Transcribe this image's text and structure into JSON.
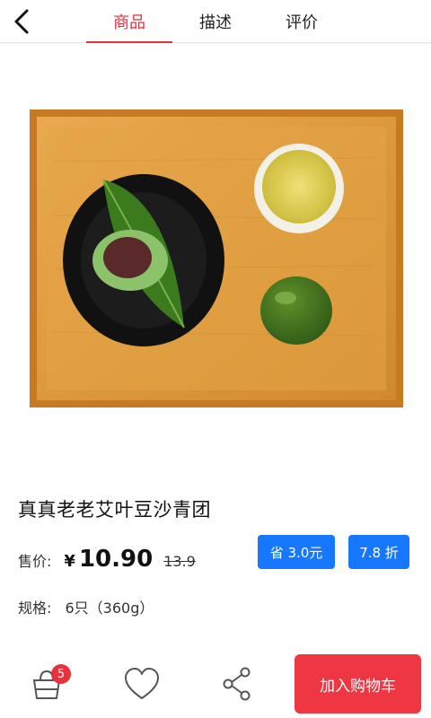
{
  "header": {
    "tabs": [
      {
        "label": "商品",
        "active": true
      },
      {
        "label": "描述",
        "active": false
      },
      {
        "label": "评价",
        "active": false
      }
    ]
  },
  "product": {
    "title": "真真老老艾叶豆沙青团",
    "price_label": "售价:",
    "currency": "¥",
    "price": "10.90",
    "original_price": "13.9",
    "save_badge": "省 3.0元",
    "discount_badge": "7.8 折",
    "spec_label": "规格:",
    "spec_value": "6只（360g）"
  },
  "bottom_bar": {
    "cart_count": "5",
    "add_to_cart_label": "加入购物车"
  },
  "colors": {
    "accent_red": "#e8313c",
    "badge_blue": "#1677ff",
    "button_red": "#ee3742"
  },
  "icons": [
    "back-arrow-icon",
    "cart-icon",
    "heart-icon",
    "share-icon"
  ]
}
